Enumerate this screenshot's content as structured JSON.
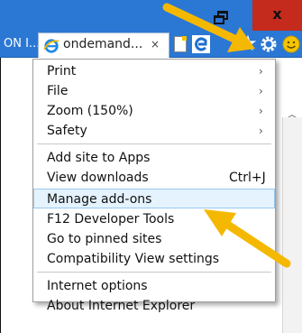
{
  "tabs": {
    "previous_tab_label": "ON I...",
    "active_tab_title": "ondemand...",
    "close_glyph": "×"
  },
  "window": {
    "close_glyph": "x"
  },
  "toolbar": {
    "favorites_glyph": "★"
  },
  "menu": {
    "items": [
      {
        "label": "Print",
        "submenu": "›"
      },
      {
        "label": "File",
        "submenu": "›"
      },
      {
        "label": "Zoom (150%)",
        "submenu": "›"
      },
      {
        "label": "Safety",
        "submenu": "›"
      },
      {
        "label": "Add site to Apps"
      },
      {
        "label": "View downloads",
        "shortcut": "Ctrl+J"
      },
      {
        "label": "Manage add-ons",
        "highlighted": true
      },
      {
        "label": "F12 Developer Tools"
      },
      {
        "label": "Go to pinned sites"
      },
      {
        "label": "Compatibility View settings"
      },
      {
        "label": "Internet options"
      },
      {
        "label": "About Internet Explorer"
      }
    ]
  },
  "colors": {
    "titlebar": "#2b77d4",
    "close_button": "#c42b1c",
    "highlight": "#e5f3ff",
    "annotation_arrow": "#f5b800"
  },
  "icons": [
    "ie-logo-icon",
    "new-tab-icon",
    "edge-icon",
    "favorites-star-icon",
    "tools-gear-icon",
    "feedback-smiley-icon",
    "window-restore-icon",
    "scroll-up-icon"
  ]
}
